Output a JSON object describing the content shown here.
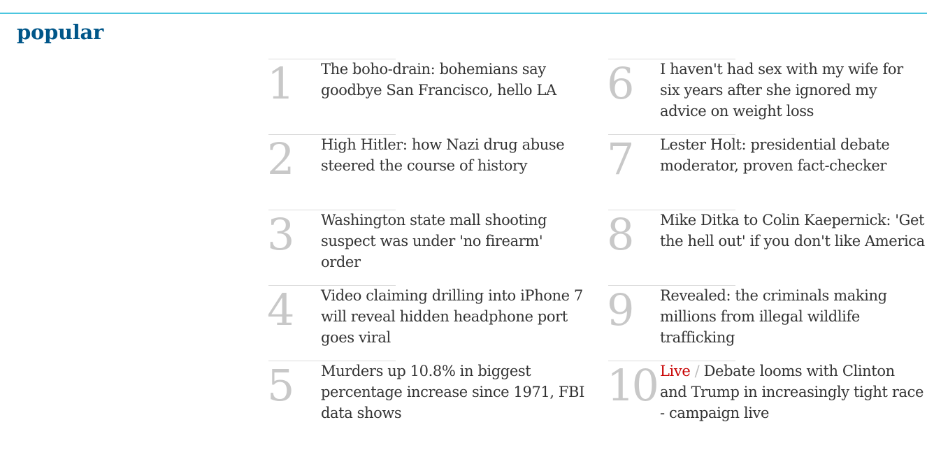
{
  "section": {
    "title": "popular"
  },
  "colors": {
    "rule_accent": "#4bc6df",
    "title": "#005689",
    "live": "#c70000",
    "rank": "#c8c8c8"
  },
  "items": [
    {
      "rank": "1",
      "headline": "The boho-drain: bohemians say goodbye San Francisco, hello LA"
    },
    {
      "rank": "2",
      "headline": "High Hitler: how Nazi drug abuse steered the course of history"
    },
    {
      "rank": "3",
      "headline": "Washington state mall shooting suspect was under 'no firearm' order"
    },
    {
      "rank": "4",
      "headline": "Video claiming drilling into iPhone 7 will reveal hidden headphone port goes viral"
    },
    {
      "rank": "5",
      "headline": "Murders up 10.8% in biggest percentage increase since 1971, FBI data shows"
    },
    {
      "rank": "6",
      "headline": "I haven't had sex with my wife for six years after she ignored my advice on weight loss"
    },
    {
      "rank": "7",
      "headline": "Lester Holt: presidential debate moderator, proven fact-checker"
    },
    {
      "rank": "8",
      "headline": "Mike Ditka to Colin Kaepernick: 'Get the hell out' if you don't like America"
    },
    {
      "rank": "9",
      "headline": "Revealed: the criminals making millions from illegal wildlife trafficking"
    },
    {
      "rank": "10",
      "kicker": "Live",
      "separator": "/",
      "headline": "Debate looms with Clinton and Trump in increasingly tight race - campaign live"
    }
  ]
}
